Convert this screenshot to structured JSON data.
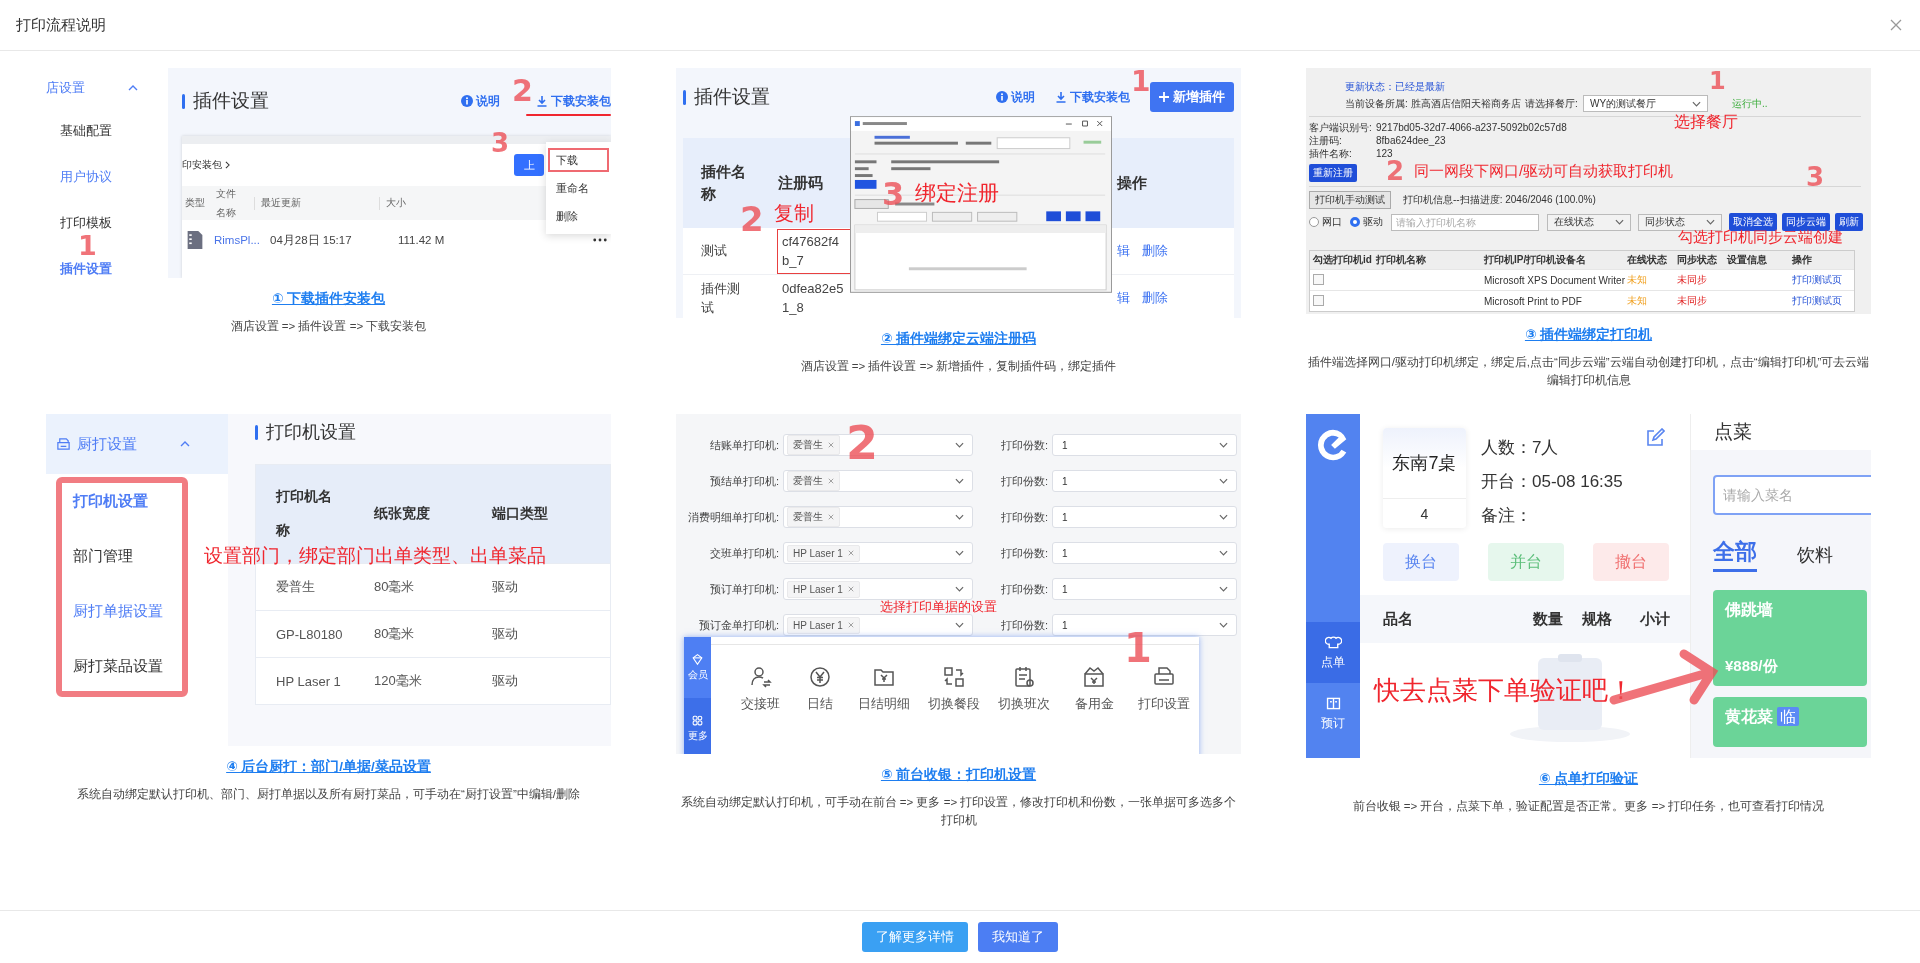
{
  "dialog": {
    "title": "打印流程说明"
  },
  "steps": [
    {
      "kind": "plugin-download",
      "title": "① 下载插件安装包",
      "caption": "酒店设置 => 插件设置 => 下载安装包",
      "screen": {
        "sidebar": {
          "group": "店设置",
          "items": [
            {
              "label": "基础配置",
              "selected": false,
              "highlighted": false
            },
            {
              "label": "用户协议",
              "selected": false,
              "highlighted": true
            },
            {
              "label": "打印模板",
              "selected": false,
              "highlighted": false
            },
            {
              "label": "插件设置",
              "selected": true,
              "highlighted": true
            }
          ]
        },
        "header": "插件设置",
        "help": "说明",
        "download": "下载安装包",
        "breadcrumb": "印安装包",
        "upload": "上",
        "columns": [
          "类型",
          "文件名称",
          "最近更新",
          "大小"
        ],
        "file": {
          "name": "RimsPl...",
          "updated": "04月28日 15:17",
          "size": "111.42 M"
        },
        "menu": [
          {
            "label": "下载",
            "selected": true
          },
          {
            "label": "重命名",
            "selected": false
          },
          {
            "label": "删除",
            "selected": false
          }
        ],
        "marks": [
          "1",
          "2",
          "3"
        ]
      }
    },
    {
      "kind": "plugin-register",
      "title": "② 插件端绑定云端注册码",
      "caption": "酒店设置 => 插件设置 => 新增插件，复制插件码，绑定插件",
      "screen": {
        "header": "插件设置",
        "help": "说明",
        "download": "下载安装包",
        "add": "新增插件",
        "columns": [
          "插件名称",
          "注册码",
          "操作"
        ],
        "rows": [
          {
            "name": "测试",
            "code": "cf47682f4b_7",
            "highlighted": true,
            "actions": [
              "辑",
              "删除"
            ]
          },
          {
            "name": "插件测试",
            "code": "0dfea82e51_8",
            "highlighted": false,
            "actions": [
              "辑",
              "删除"
            ]
          }
        ],
        "marks": [
          "1",
          "2",
          "3"
        ],
        "notes": [
          "复制",
          "绑定注册"
        ]
      }
    },
    {
      "kind": "plugin-printers",
      "title": "③ 插件端绑定打印机",
      "caption": "插件端选择网口/驱动打印机绑定，绑定后,点击“同步云端”云端自动创建打印机，点击“编辑打印机”可去云端编辑打印机信息",
      "screen": {
        "update": "更新状态：已经是最新",
        "device": "当前设备所属: 胜高酒店信阳天裕商务店",
        "restaurant_label": "请选择餐厅:",
        "restaurant": "WY的测试餐厅",
        "status": "运行中..",
        "fields": [
          {
            "label": "客户端识别号:",
            "value": "9217bd05-32d7-4066-a237-5092b02c57d8"
          },
          {
            "label": "注册码:",
            "value": "8fba624dee_23"
          },
          {
            "label": "插件名称:",
            "value": "123"
          }
        ],
        "reregister": "重新注册",
        "test_button": "打印机手动测试",
        "scan": "打印机信息--扫描进度: 2046/2046 (100.0%)",
        "ports": [
          {
            "label": "网口",
            "selected": false
          },
          {
            "label": "驱动",
            "selected": true
          }
        ],
        "search_placeholder": "请输入打印机名称",
        "filters": [
          "在线状态",
          "同步状态"
        ],
        "buttons": [
          "取消全选",
          "同步云端",
          "刷新"
        ],
        "columns": [
          "勾选",
          "打印机id",
          "打印机名称",
          "打印机IP/打印机设备名",
          "在线状态",
          "同步状态",
          "设置信息",
          "操作"
        ],
        "rows": [
          {
            "checked": false,
            "name": "Microsoft XPS Document Writer",
            "online": "未知",
            "sync": "未同步",
            "action": "打印测试页"
          },
          {
            "checked": false,
            "name": "Microsoft Print to PDF",
            "online": "未知",
            "sync": "未同步",
            "action": "打印测试页"
          }
        ],
        "marks": [
          "1",
          "2",
          "3"
        ],
        "notes": [
          "选择餐厅",
          "同一网段下网口/驱动可自动获取打印机",
          "勾选打印机同步云端创建"
        ]
      }
    },
    {
      "kind": "kitchen-printers",
      "title": "④ 后台厨打：部门/单据/菜品设置",
      "caption": "系统自动绑定默认打印机、部门、厨打单据以及所有厨打菜品，可手动在“厨打设置”中编辑/删除",
      "screen": {
        "sidebar": {
          "group": "厨打设置",
          "items": [
            {
              "label": "打印机设置",
              "selected": true,
              "highlighted": true
            },
            {
              "label": "部门管理",
              "selected": false,
              "highlighted": false
            },
            {
              "label": "厨打单据设置",
              "selected": false,
              "highlighted": true
            },
            {
              "label": "厨打菜品设置",
              "selected": false,
              "highlighted": false
            }
          ]
        },
        "header": "打印机设置",
        "columns": [
          "打印机名称",
          "纸张宽度",
          "端口类型"
        ],
        "rows": [
          [
            "爱普生",
            "80毫米",
            "驱动"
          ],
          [
            "GP-L80180",
            "80毫米",
            "驱动"
          ],
          [
            "HP Laser 1",
            "120毫米",
            "驱动"
          ]
        ],
        "note": "设置部门，绑定部门出单类型、出单菜品"
      }
    },
    {
      "kind": "cashier-settings",
      "title": "⑤ 前台收银：打印机设置",
      "caption": "系统自动绑定默认打印机，可手动在前台 => 更多 => 打印设置，修改打印机和份数，一张单据可多选多个打印机",
      "screen": {
        "rows": [
          {
            "label": "结账单打印机:",
            "tags": [
              "爱普生"
            ],
            "copies_label": "打印份数:",
            "copies": "1"
          },
          {
            "label": "预结单打印机:",
            "tags": [
              "爱普生"
            ],
            "copies_label": "打印份数:",
            "copies": "1"
          },
          {
            "label": "消费明细单打印机:",
            "tags": [
              "爱普生"
            ],
            "copies_label": "打印份数:",
            "copies": "1"
          },
          {
            "label": "交班单打印机:",
            "tags": [
              "HP Laser 1"
            ],
            "copies_label": "打印份数:",
            "copies": "1"
          },
          {
            "label": "预订单打印机:",
            "tags": [
              "HP Laser 1"
            ],
            "copies_label": "打印份数:",
            "copies": "1"
          },
          {
            "label": "预订金单打印机:",
            "tags": [
              "HP Laser 1"
            ],
            "copies_label": "打印份数:",
            "copies": "1"
          }
        ],
        "note": "选择打印单据的设置",
        "marks": [
          "2",
          "1"
        ],
        "nav": [
          "会员",
          "更多"
        ],
        "tools": [
          "交接班",
          "日结",
          "日结明细",
          "切换餐段",
          "切换班次",
          "备用金",
          "打印设置"
        ]
      }
    },
    {
      "kind": "order-check",
      "title": "⑥ 点单打印验证",
      "caption": "前台收银 => 开台，点菜下单，验证配置是否正常。更多 => 打印任务，也可查看打印情况",
      "screen": {
        "nav": [
          {
            "label": "点单",
            "selected": true
          },
          {
            "label": "预订",
            "selected": false
          }
        ],
        "table": {
          "name": "东南7桌",
          "seats": "4",
          "info": [
            "人数：7人",
            "开台：05-08 16:35",
            "备注："
          ]
        },
        "actions": [
          {
            "label": "换台",
            "kind": "primary"
          },
          {
            "label": "并台",
            "kind": "success"
          },
          {
            "label": "撤台",
            "kind": "danger"
          }
        ],
        "columns": [
          "品名",
          "数量",
          "规格",
          "小计"
        ],
        "note": "快去点菜下单验证吧！",
        "menu": {
          "title": "点菜",
          "placeholder": "请输入菜名",
          "tabs": [
            {
              "label": "全部",
              "selected": true
            },
            {
              "label": "饮料",
              "selected": false
            }
          ],
          "dishes": [
            {
              "name": "佛跳墙",
              "price": "¥888/份"
            },
            {
              "name": "黄花菜",
              "badge": "临"
            }
          ]
        }
      }
    }
  ],
  "footer": {
    "buttons": [
      "了解更多详情",
      "我知道了"
    ]
  }
}
